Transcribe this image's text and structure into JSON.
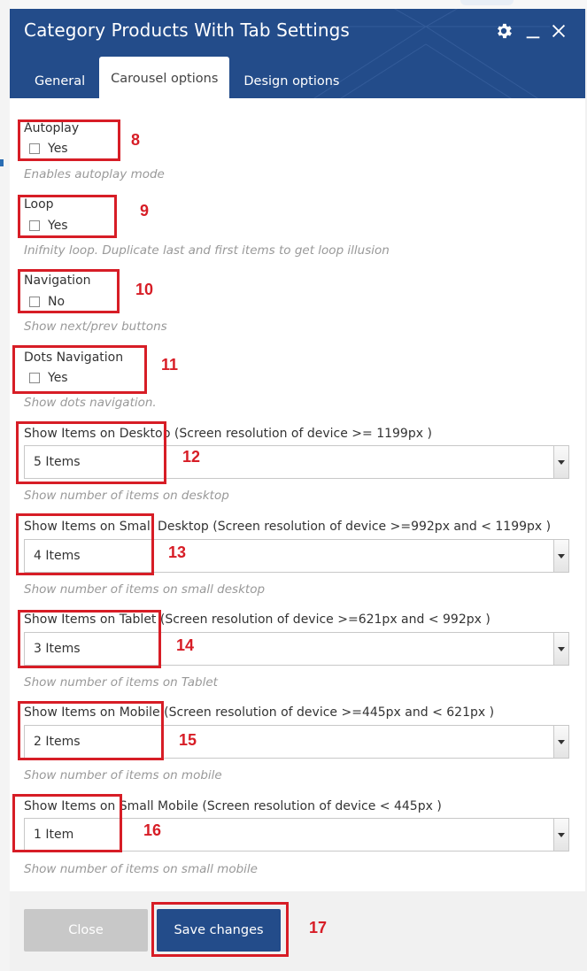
{
  "modal": {
    "title": "Category Products With Tab Settings",
    "icons": [
      "gear-icon",
      "minimize-icon",
      "close-icon"
    ],
    "tabs": [
      {
        "label": "General",
        "active": false
      },
      {
        "label": "Carousel options",
        "active": true
      },
      {
        "label": "Design options",
        "active": false
      }
    ]
  },
  "fields": {
    "autoplay": {
      "label": "Autoplay",
      "option": "Yes",
      "checked": false,
      "description": "Enables autoplay mode"
    },
    "loop": {
      "label": "Loop",
      "option": "Yes",
      "checked": false,
      "description": "Inifnity loop. Duplicate last and first items to get loop illusion"
    },
    "navigation": {
      "label": "Navigation",
      "option": "No",
      "checked": false,
      "description": "Show next/prev buttons"
    },
    "dots": {
      "label": "Dots Navigation",
      "option": "Yes",
      "checked": false,
      "description": "Show dots navigation."
    },
    "desktop": {
      "label": "Show Items on Desktop (Screen resolution of device >= 1199px )",
      "value": "5 Items",
      "description": "Show number of items on desktop"
    },
    "small_desktop": {
      "label": "Show Items on Small Desktop (Screen resolution of device >=992px and < 1199px )",
      "value": "4 Items",
      "description": "Show number of items on small desktop"
    },
    "tablet": {
      "label": "Show Items on Tablet (Screen resolution of device >=621px and < 992px )",
      "value": "3 Items",
      "description": "Show number of items on Tablet"
    },
    "mobile": {
      "label": "Show Items on Mobile (Screen resolution of device >=445px and < 621px )",
      "value": "2 Items",
      "description": "Show number of items on mobile"
    },
    "small_mobile": {
      "label": "Show Items on Small Mobile (Screen resolution of device < 445px )",
      "value": "1 Item",
      "description": "Show number of items on small mobile"
    }
  },
  "footer": {
    "close_label": "Close",
    "save_label": "Save changes"
  },
  "annotations": [
    "8",
    "9",
    "10",
    "11",
    "12",
    "13",
    "14",
    "15",
    "16",
    "17"
  ],
  "colors": {
    "header": "#234c8a",
    "annotation": "#d71d26",
    "close_button": "#c8c8c8"
  }
}
